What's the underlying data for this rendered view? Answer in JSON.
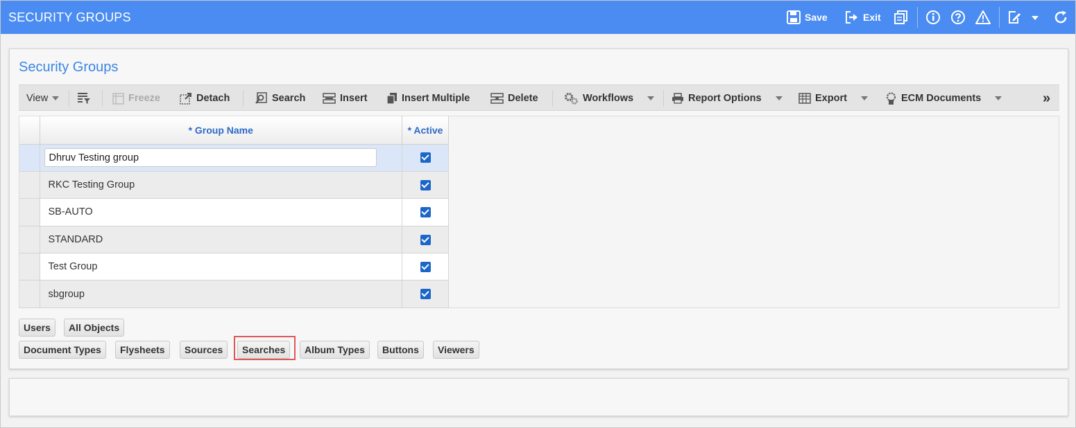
{
  "app": {
    "title": "SECURITY GROUPS"
  },
  "topbar": {
    "save_label": "Save",
    "exit_label": "Exit",
    "icons": [
      "save-icon",
      "exit-icon",
      "print-copy-icon",
      "info-icon",
      "help-icon",
      "warning-icon",
      "edit-note-icon",
      "chevron-down-icon",
      "refresh-icon"
    ]
  },
  "panel": {
    "title": "Security Groups"
  },
  "toolbar": {
    "view": "View",
    "freeze": "Freeze",
    "detach": "Detach",
    "search": "Search",
    "insert": "Insert",
    "insert_multiple": "Insert Multiple",
    "delete": "Delete",
    "workflows": "Workflows",
    "report_options": "Report Options",
    "export": "Export",
    "ecm_documents": "ECM Documents",
    "more": "»"
  },
  "grid": {
    "columns": [
      "* Group Name",
      "* Active"
    ],
    "rows": [
      {
        "name": "Dhruv Testing group",
        "active": true,
        "editing": true
      },
      {
        "name": "RKC Testing Group",
        "active": true
      },
      {
        "name": "SB-AUTO",
        "active": true
      },
      {
        "name": "STANDARD",
        "active": true
      },
      {
        "name": "Test Group",
        "active": true
      },
      {
        "name": "sbgroup",
        "active": true
      }
    ]
  },
  "tabs_row1": [
    "Users",
    "All Objects"
  ],
  "tabs_row2": [
    "Document Types",
    "Flysheets",
    "Sources",
    "Searches",
    "Album Types",
    "Buttons",
    "Viewers"
  ],
  "highlighted_tab": "Searches",
  "colors": {
    "header": "#4a8cf2",
    "title": "#3a86e4",
    "checkbox": "#1b66c9",
    "highlight": "#e05555"
  }
}
